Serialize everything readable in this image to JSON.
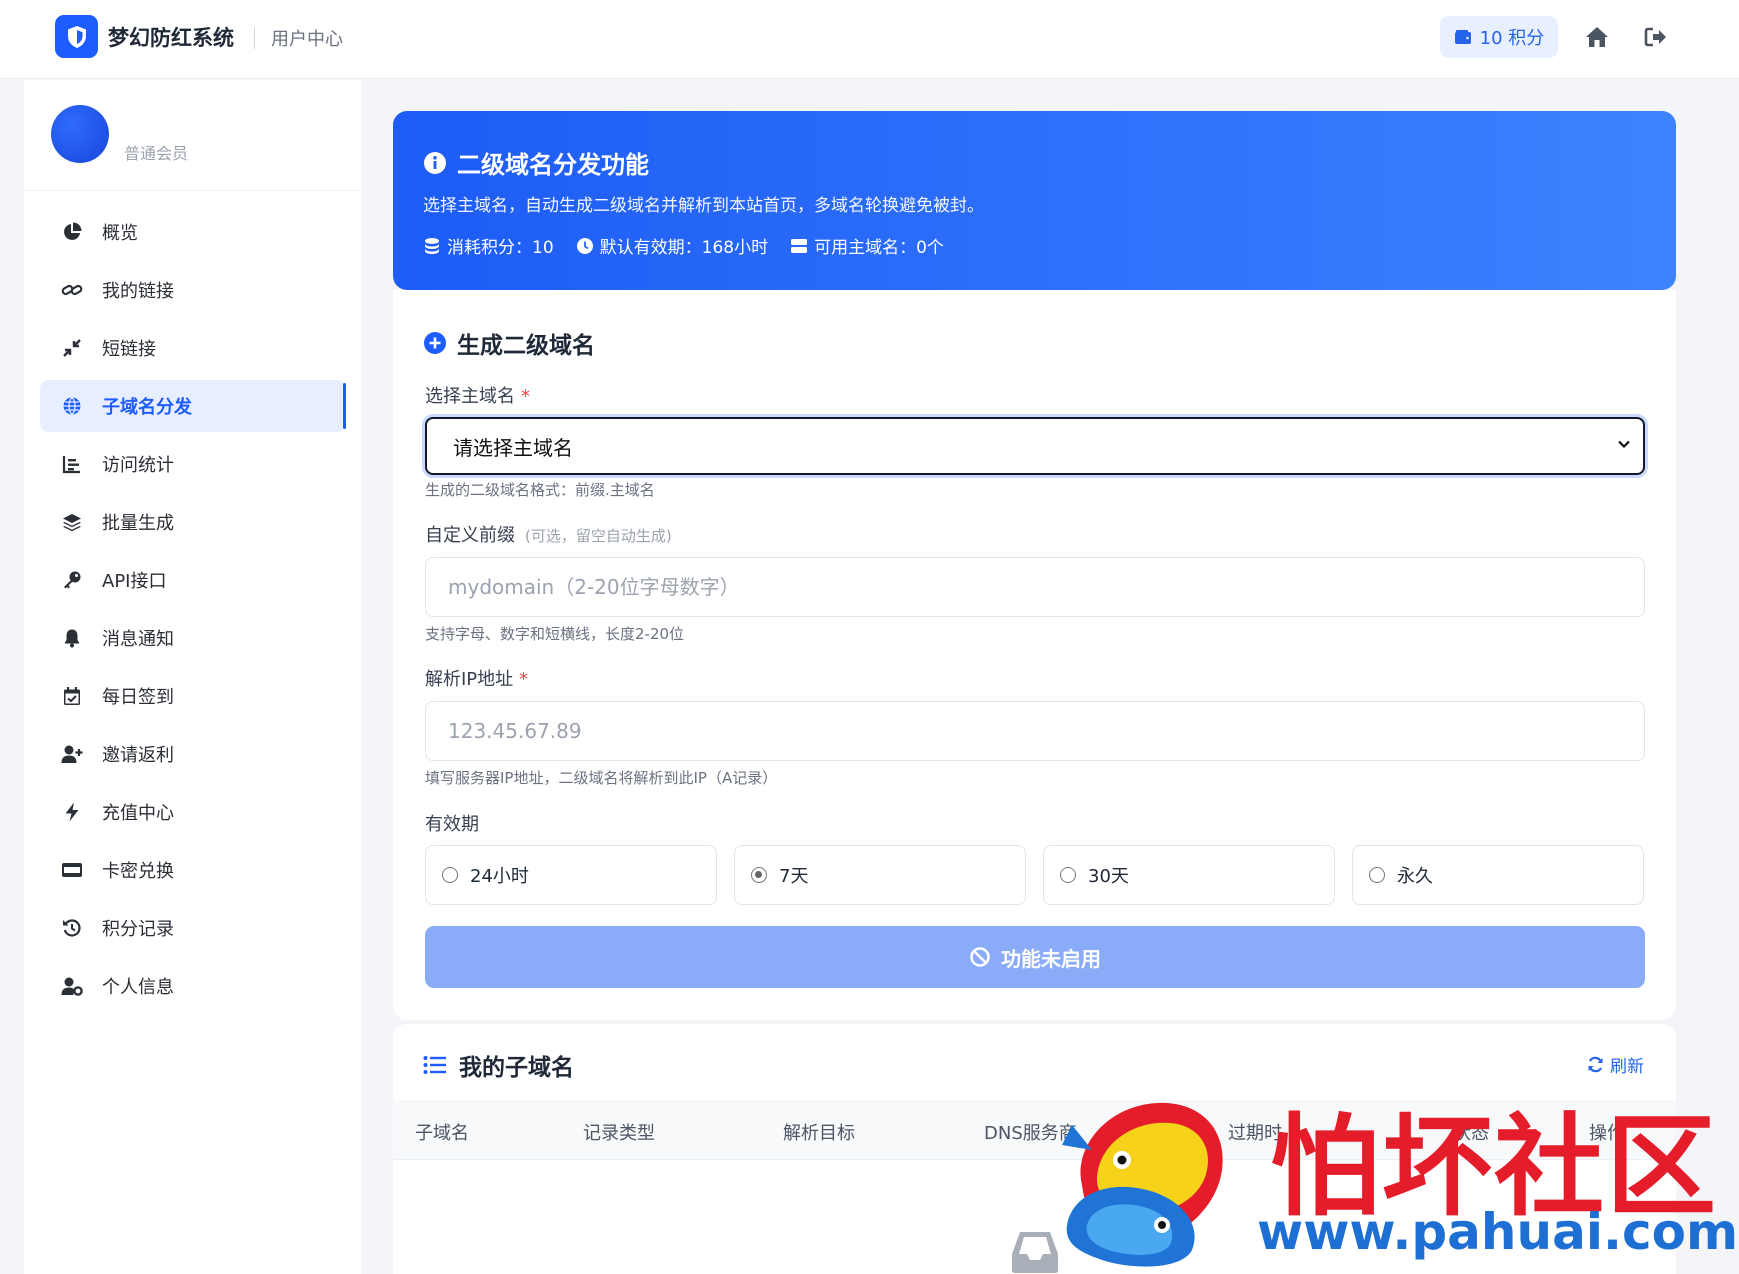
{
  "header": {
    "brand": "梦幻防红系统",
    "subtitle": "用户中心",
    "points": "10 积分"
  },
  "user": {
    "level": "普通会员"
  },
  "sidebar": {
    "items": [
      {
        "label": "概览",
        "icon": "pie-chart-icon"
      },
      {
        "label": "我的链接",
        "icon": "link-icon"
      },
      {
        "label": "短链接",
        "icon": "compress-icon"
      },
      {
        "label": "子域名分发",
        "icon": "globe-icon",
        "active": true
      },
      {
        "label": "访问统计",
        "icon": "bar-chart-icon"
      },
      {
        "label": "批量生成",
        "icon": "layers-icon"
      },
      {
        "label": "API接口",
        "icon": "key-icon"
      },
      {
        "label": "消息通知",
        "icon": "bell-icon"
      },
      {
        "label": "每日签到",
        "icon": "calendar-icon"
      },
      {
        "label": "邀请返利",
        "icon": "user-plus-icon"
      },
      {
        "label": "充值中心",
        "icon": "bolt-icon"
      },
      {
        "label": "卡密兑换",
        "icon": "card-icon"
      },
      {
        "label": "积分记录",
        "icon": "history-icon"
      },
      {
        "label": "个人信息",
        "icon": "user-cog-icon"
      }
    ]
  },
  "hero": {
    "title": "二级域名分发功能",
    "description": "选择主域名，自动生成二级域名并解析到本站首页，多域名轮换避免被封。",
    "stat_cost": "消耗积分：10",
    "stat_validity": "默认有效期：168小时",
    "stat_domains": "可用主域名：0个"
  },
  "form": {
    "title": "生成二级域名",
    "domain_label": "选择主域名",
    "required_mark": "*",
    "domain_selected": "请选择主域名",
    "domain_hint": "生成的二级域名格式：前缀.主域名",
    "prefix_label": "自定义前缀",
    "prefix_optional": "(可选，留空自动生成)",
    "prefix_placeholder": "mydomain（2-20位字母数字）",
    "prefix_hint": "支持字母、数字和短横线，长度2-20位",
    "ip_label": "解析IP地址",
    "ip_placeholder": "123.45.67.89",
    "ip_hint": "填写服务器IP地址，二级域名将解析到此IP（A记录）",
    "validity_label": "有效期",
    "validity_options": [
      {
        "label": "24小时",
        "checked": false
      },
      {
        "label": "7天",
        "checked": true
      },
      {
        "label": "30天",
        "checked": false
      },
      {
        "label": "永久",
        "checked": false
      }
    ],
    "submit_label": "功能未启用"
  },
  "list": {
    "title": "我的子域名",
    "refresh_label": "刷新",
    "columns": [
      "子域名",
      "记录类型",
      "解析目标",
      "DNS服务商",
      "过期时",
      "状态",
      "操作"
    ]
  },
  "watermark": {
    "title": "怕坏社区",
    "url": "www.pahuai.com"
  },
  "colors": {
    "primary": "#1f5cff",
    "hero_gradient_start": "#1d5cf5",
    "hero_gradient_end": "#3d82ff",
    "disabled_button": "#8aabf7",
    "required": "#ef4444"
  }
}
